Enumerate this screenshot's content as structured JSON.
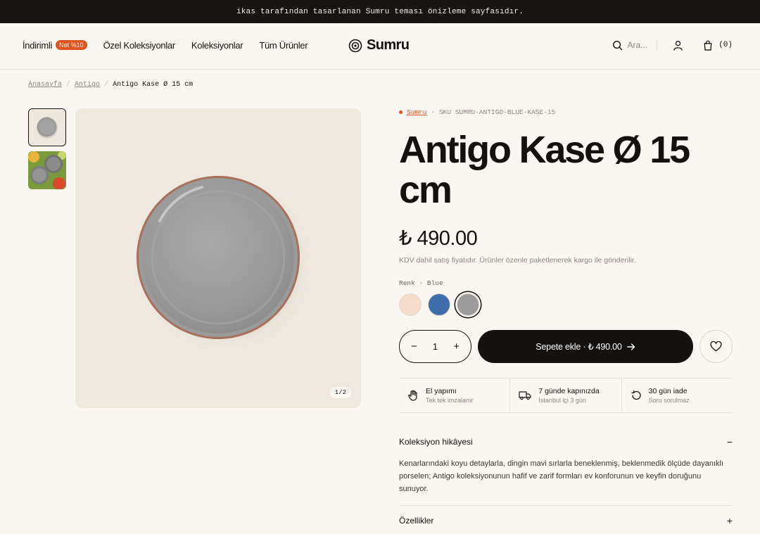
{
  "announcement": "ikas tarafından tasarlanan Sumru teması önizleme sayfasıdır.",
  "nav": {
    "items": [
      {
        "label": "İndirimli",
        "badge": "Net %10"
      },
      {
        "label": "Özel Koleksiyonlar"
      },
      {
        "label": "Koleksiyonlar"
      },
      {
        "label": "Tüm Ürünler"
      }
    ]
  },
  "logo": "Sumru",
  "search": {
    "placeholder": "Ara..."
  },
  "cart": {
    "count": "(0)"
  },
  "breadcrumb": [
    "Anasayfa",
    "Antigo",
    "Antigo Kase Ø 15 cm"
  ],
  "gallery": {
    "counter": "1/2"
  },
  "product": {
    "brand": "Sumru",
    "sku": "· SKU SUMRU-ANTIGO-BLUE-KASE-15",
    "title": "Antigo Kase Ø 15 cm",
    "price": "₺ 490.00",
    "tax_note": "KDV dahil satış fiyatıdır. Ürünler özenle paketlenerek kargo ile gönderilir.",
    "color_label": "Renk · Blue",
    "swatches": [
      "#f6dccb",
      "#3f6cab",
      "#9c9c9c"
    ],
    "selected_swatch": 2,
    "quantity": "1",
    "add_to_cart": "Sepete ekle · ₺ 490.00"
  },
  "features": [
    {
      "icon": "hand-icon",
      "title": "El yapımı",
      "subtitle": "Tek tek imzalanır"
    },
    {
      "icon": "truck-icon",
      "title": "7 günde kapınızda",
      "subtitle": "İstanbul içi 3 gün"
    },
    {
      "icon": "return-icon",
      "title": "30 gün iade",
      "subtitle": "Soru sorulmaz"
    }
  ],
  "accordion": {
    "story_title": "Koleksiyon hikâyesi",
    "story_body": "Kenarlarındaki koyu detaylarla, dingin mavi sırlarla beneklenmiş, beklenmedik ölçüde dayanıklı porselen; Antigo koleksiyonunun hafif ve zarif formları ev konforunun ve keyfin doruğunu sunuyor.",
    "features_title": "Özellikler"
  },
  "colors": {
    "accent": "#e0531f",
    "dark": "#141210",
    "background": "#faf6f1"
  }
}
